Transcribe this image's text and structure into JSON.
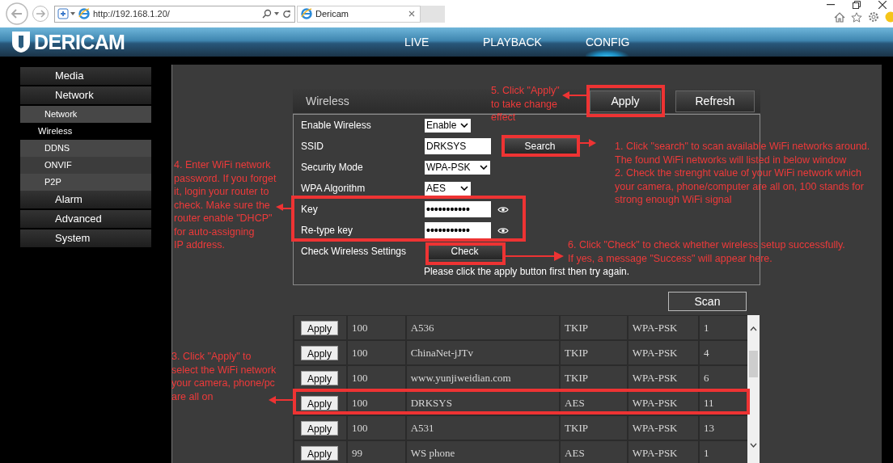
{
  "browser": {
    "url": "http://192.168.1.20/",
    "tab_title": "Dericam"
  },
  "header": {
    "logo": "DERICAM",
    "nav": [
      {
        "label": "LIVE",
        "selected": false
      },
      {
        "label": "PLAYBACK",
        "selected": false
      },
      {
        "label": "CONFIG",
        "selected": true
      }
    ]
  },
  "sidebar": {
    "items": [
      {
        "label": "Media",
        "selected": false
      },
      {
        "label": "Network",
        "selected": false,
        "children": [
          {
            "label": "Network",
            "selected": false
          },
          {
            "label": "Wireless",
            "selected": true
          },
          {
            "label": "DDNS",
            "selected": false
          },
          {
            "label": "ONVIF",
            "selected": false
          },
          {
            "label": "P2P",
            "selected": false
          }
        ]
      },
      {
        "label": "Alarm",
        "selected": false
      },
      {
        "label": "Advanced",
        "selected": false
      },
      {
        "label": "System",
        "selected": false
      }
    ]
  },
  "panel": {
    "title": "Wireless",
    "buttons": [
      "Apply",
      "Refresh"
    ],
    "rows": [
      {
        "label": "Enable Wireless",
        "kind": "select",
        "value": "Enable"
      },
      {
        "label": "SSID",
        "kind": "text",
        "value": "DRKSYS",
        "button": "Search"
      },
      {
        "label": "Security Mode",
        "kind": "select",
        "value": "WPA-PSK"
      },
      {
        "label": "WPA Algorithm",
        "kind": "select",
        "value": "AES"
      },
      {
        "label": "Key",
        "kind": "password",
        "value": "•••••••••••"
      },
      {
        "label": "Re-type key",
        "kind": "password",
        "value": "•••••••••••"
      },
      {
        "label": "Check Wireless Settings",
        "kind": "button",
        "button": "Check"
      }
    ],
    "note": "Please click the apply button first then try again."
  },
  "scan_button": "Scan",
  "networks": {
    "rows": [
      {
        "button": "Apply",
        "cells": [
          "100",
          "A536",
          "TKIP",
          "WPA-PSK",
          "1"
        ]
      },
      {
        "button": "Apply",
        "cells": [
          "100",
          "ChinaNet-jJTv",
          "TKIP",
          "WPA-PSK",
          "4"
        ]
      },
      {
        "button": "Apply",
        "cells": [
          "100",
          "www.yunjiweidian.com",
          "TKIP",
          "WPA-PSK",
          "6"
        ]
      },
      {
        "button": "Apply",
        "cells": [
          "100",
          "DRKSYS",
          "AES",
          "WPA-PSK",
          "11"
        ]
      },
      {
        "button": "Apply",
        "cells": [
          "100",
          "A531",
          "TKIP",
          "WPA-PSK",
          "13"
        ]
      },
      {
        "button": "Apply",
        "cells": [
          "99",
          "WS phone",
          "AES",
          "WPA-PSK",
          "1"
        ]
      }
    ]
  },
  "annotations": [
    {
      "text": "5. Click \"Apply\"\nto take change\neffect"
    },
    {
      "text": "1. Click \"search\" to scan available WiFi networks around.\nThe found WiFi networks will listed in below window\n2. Check the strenght value of your WiFi network which\nyour camera, phone/computer are all on, 100 stands for\nstrong enough WiFi signal"
    },
    {
      "text": "4. Enter WiFi network\npassword. If you forget\nit, login your router to\ncheck. Make sure the\nrouter enable \"DHCP\"\nfor auto-assigning\nIP address."
    },
    {
      "text": "6. Click \"Check\" to check whether wireless setup successfully.\nIf yes, a message \"Success\" will appear here."
    },
    {
      "text": "3. Click \"Apply\" to\nselect the WiFi network\nyour camera, phone/pc\nare all on"
    }
  ]
}
